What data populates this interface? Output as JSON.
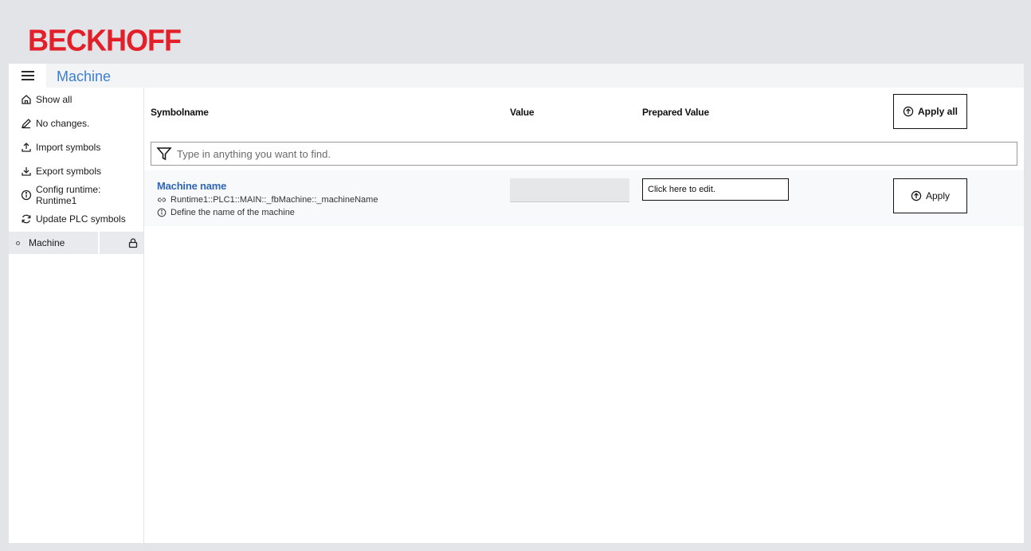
{
  "brand": {
    "logo_text": "BECKHOFF",
    "color": "#e3202a"
  },
  "header": {
    "title": "Machine"
  },
  "sidebar": {
    "items": [
      {
        "label": "Show all",
        "icon": "home-icon"
      },
      {
        "label": "No changes.",
        "icon": "pencil-icon"
      },
      {
        "label": "Import symbols",
        "icon": "upload-icon"
      },
      {
        "label": "Export symbols",
        "icon": "download-icon"
      },
      {
        "label": "Config runtime: Runtime1",
        "icon": "info-icon"
      },
      {
        "label": "Update PLC symbols",
        "icon": "refresh-icon"
      }
    ],
    "tree": [
      {
        "label": "Machine",
        "icon": "lock-icon"
      }
    ]
  },
  "table": {
    "columns": [
      "Symbolname",
      "Value",
      "Prepared Value"
    ],
    "apply_all_label": "Apply all",
    "filter_placeholder": "Type in anything you want to find.",
    "rows": [
      {
        "title": "Machine name",
        "path": "Runtime1::PLC1::MAIN::_fbMachine::_machineName",
        "description": "Define the name of the machine",
        "value": "",
        "prepared_value": "Click here to edit.",
        "apply_label": "Apply"
      }
    ]
  },
  "colors": {
    "accent": "#3d7dd0",
    "symbol_title": "#2f67b5",
    "background": "#e2e4e7"
  }
}
